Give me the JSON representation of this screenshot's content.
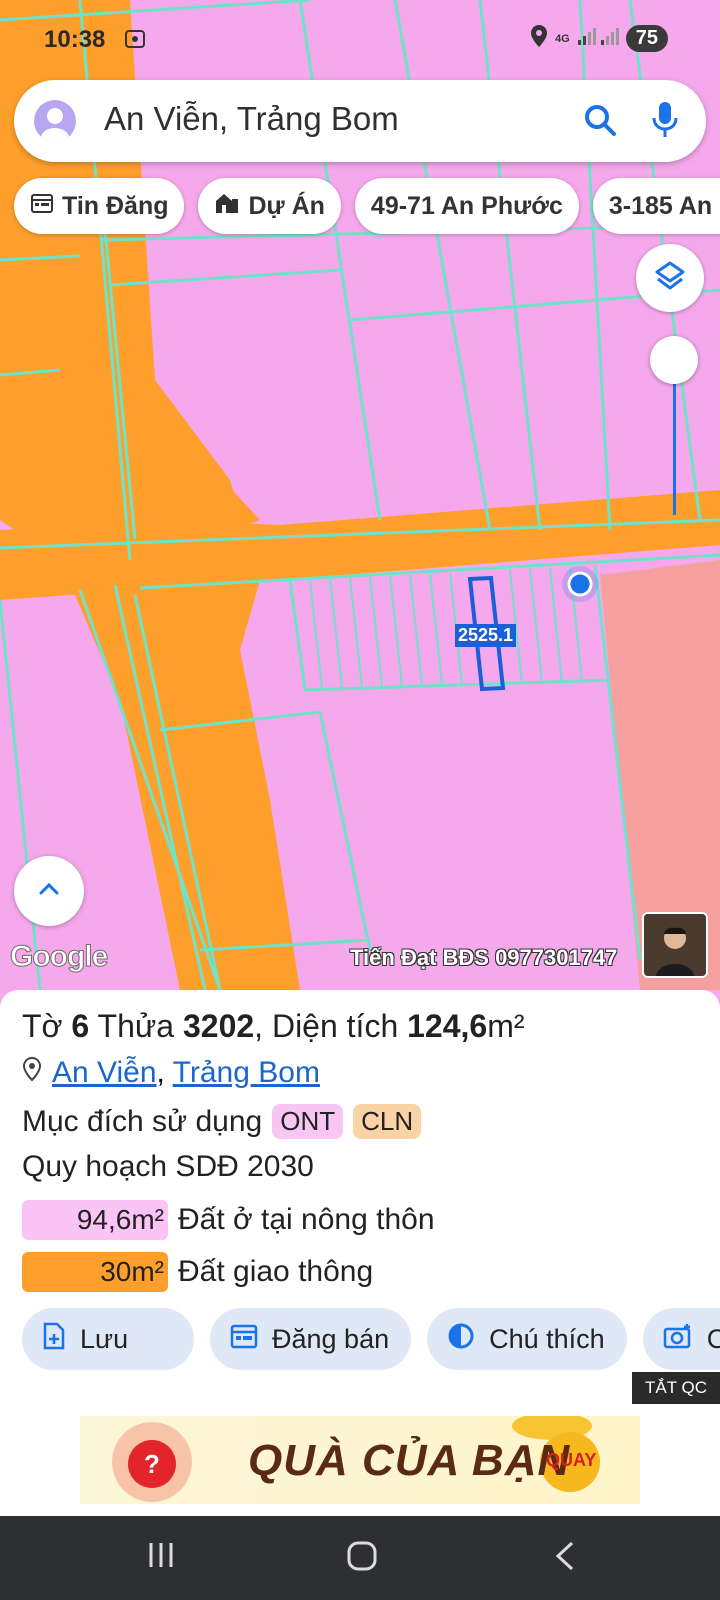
{
  "status_bar": {
    "time": "10:38",
    "network": "4G",
    "battery": "75"
  },
  "search": {
    "query": "An Viễn, Trảng Bom"
  },
  "chips": [
    {
      "label": "Tin Đăng",
      "icon": "calendar-icon"
    },
    {
      "label": "Dự Án",
      "icon": "building-icon"
    },
    {
      "label": "49-71 An Phước",
      "icon": ""
    },
    {
      "label": "3-185 An P",
      "icon": ""
    }
  ],
  "map": {
    "plot_label": "2525.1",
    "attribution": "Google",
    "watermark": "Tiến Đạt BĐS 0977301747"
  },
  "panel": {
    "title_prefix": "Tờ",
    "sheet_no": "6",
    "title_mid": "Thửa",
    "parcel_no": "3202",
    "area_label": ", Diện tích",
    "area_value": "124,6",
    "area_unit": "m²",
    "location_commune": "An Viễn",
    "location_sep": ",",
    "location_district": "Trảng Bom",
    "purpose_label": "Mục đích sử dụng",
    "purpose_tags": [
      "ONT",
      "CLN"
    ],
    "plan_label": "Quy hoạch SDĐ 2030",
    "legend": [
      {
        "value": "94,6m²",
        "label": "Đất ở tại nông thôn",
        "color": "#fbc4f6"
      },
      {
        "value": "30m²",
        "label": "Đất giao thông",
        "color": "#ff9f2b"
      }
    ],
    "actions": [
      {
        "label": "Lưu",
        "icon": "save-icon"
      },
      {
        "label": "Đăng bán",
        "icon": "calendar-icon"
      },
      {
        "label": "Chú thích",
        "icon": "contrast-icon"
      },
      {
        "label": "C",
        "icon": "camera-icon"
      }
    ]
  },
  "ad": {
    "close_label": "TẮT QC",
    "text": "QUÀ CỦA BẠN",
    "badge": "QUAY"
  },
  "colors": {
    "residential": "#f5a8ec",
    "road": "#ff9f2b",
    "boundary": "#6fe3c9",
    "accent": "#1a73e8"
  }
}
